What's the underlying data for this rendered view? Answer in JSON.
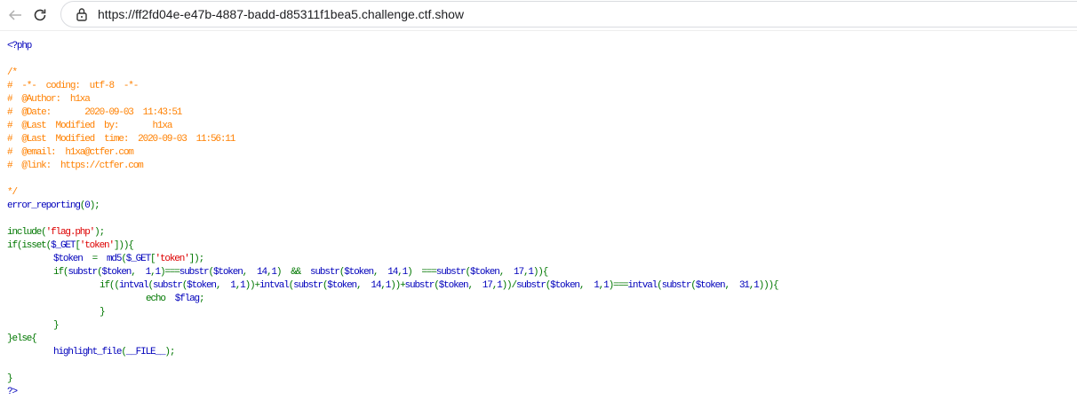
{
  "browser": {
    "url": "https://ff2fd04e-e47b-4887-badd-d85311f1bea5.challenge.ctf.show"
  },
  "colors": {
    "default": "#0000BB",
    "keyword": "#007700",
    "string": "#DD0000",
    "comment": "#FF8000"
  },
  "code_lines": [
    {
      "indent": 0,
      "t": [
        [
          "b",
          "<?php"
        ]
      ]
    },
    {
      "indent": 0,
      "t": []
    },
    {
      "indent": 0,
      "t": [
        [
          "o",
          "/*"
        ]
      ]
    },
    {
      "indent": 0,
      "t": [
        [
          "o",
          "#  -*-  coding:  utf-8  -*-"
        ]
      ]
    },
    {
      "indent": 0,
      "t": [
        [
          "o",
          "#  @Author:  h1xa"
        ]
      ]
    },
    {
      "indent": 0,
      "t": [
        [
          "o",
          "#  @Date:       2020-09-03  11:43:51"
        ]
      ]
    },
    {
      "indent": 0,
      "t": [
        [
          "o",
          "#  @Last  Modified  by:       h1xa"
        ]
      ]
    },
    {
      "indent": 0,
      "t": [
        [
          "o",
          "#  @Last  Modified  time:  2020-09-03  11:56:11"
        ]
      ]
    },
    {
      "indent": 0,
      "t": [
        [
          "o",
          "#  @email:  h1xa@ctfer.com"
        ]
      ]
    },
    {
      "indent": 0,
      "t": [
        [
          "o",
          "#  @link:  https://ctfer.com"
        ]
      ]
    },
    {
      "indent": 0,
      "t": []
    },
    {
      "indent": 0,
      "t": [
        [
          "o",
          "*/"
        ]
      ]
    },
    {
      "indent": 0,
      "t": [
        [
          "b",
          "error_reporting"
        ],
        [
          "g",
          "("
        ],
        [
          "b",
          "0"
        ],
        [
          "g",
          ");"
        ]
      ]
    },
    {
      "indent": 0,
      "t": []
    },
    {
      "indent": 0,
      "t": [
        [
          "g",
          "include("
        ],
        [
          "r",
          "'flag.php'"
        ],
        [
          "g",
          ");"
        ]
      ]
    },
    {
      "indent": 0,
      "t": [
        [
          "g",
          "if(isset("
        ],
        [
          "b",
          "$_GET"
        ],
        [
          "g",
          "["
        ],
        [
          "r",
          "'token'"
        ],
        [
          "g",
          "])){"
        ]
      ]
    },
    {
      "indent": 1,
      "t": [
        [
          "b",
          "$token  "
        ],
        [
          "g",
          "=  "
        ],
        [
          "b",
          "md5"
        ],
        [
          "g",
          "("
        ],
        [
          "b",
          "$_GET"
        ],
        [
          "g",
          "["
        ],
        [
          "r",
          "'token'"
        ],
        [
          "g",
          "]);"
        ]
      ]
    },
    {
      "indent": 1,
      "t": [
        [
          "g",
          "if("
        ],
        [
          "b",
          "substr"
        ],
        [
          "g",
          "("
        ],
        [
          "b",
          "$token"
        ],
        [
          "g",
          ",  "
        ],
        [
          "b",
          "1"
        ],
        [
          "g",
          ","
        ],
        [
          "b",
          "1"
        ],
        [
          "g",
          ")==="
        ],
        [
          "b",
          "substr"
        ],
        [
          "g",
          "("
        ],
        [
          "b",
          "$token"
        ],
        [
          "g",
          ",  "
        ],
        [
          "b",
          "14"
        ],
        [
          "g",
          ","
        ],
        [
          "b",
          "1"
        ],
        [
          "g",
          ")  &&  "
        ],
        [
          "b",
          "substr"
        ],
        [
          "g",
          "("
        ],
        [
          "b",
          "$token"
        ],
        [
          "g",
          ",  "
        ],
        [
          "b",
          "14"
        ],
        [
          "g",
          ","
        ],
        [
          "b",
          "1"
        ],
        [
          "g",
          ")  ==="
        ],
        [
          "b",
          "substr"
        ],
        [
          "g",
          "("
        ],
        [
          "b",
          "$token"
        ],
        [
          "g",
          ",  "
        ],
        [
          "b",
          "17"
        ],
        [
          "g",
          ","
        ],
        [
          "b",
          "1"
        ],
        [
          "g",
          ")){"
        ]
      ]
    },
    {
      "indent": 2,
      "t": [
        [
          "g",
          "if(("
        ],
        [
          "b",
          "intval"
        ],
        [
          "g",
          "("
        ],
        [
          "b",
          "substr"
        ],
        [
          "g",
          "("
        ],
        [
          "b",
          "$token"
        ],
        [
          "g",
          ",  "
        ],
        [
          "b",
          "1"
        ],
        [
          "g",
          ","
        ],
        [
          "b",
          "1"
        ],
        [
          "g",
          "))+"
        ],
        [
          "b",
          "intval"
        ],
        [
          "g",
          "("
        ],
        [
          "b",
          "substr"
        ],
        [
          "g",
          "("
        ],
        [
          "b",
          "$token"
        ],
        [
          "g",
          ",  "
        ],
        [
          "b",
          "14"
        ],
        [
          "g",
          ","
        ],
        [
          "b",
          "1"
        ],
        [
          "g",
          "))+"
        ],
        [
          "b",
          "substr"
        ],
        [
          "g",
          "("
        ],
        [
          "b",
          "$token"
        ],
        [
          "g",
          ",  "
        ],
        [
          "b",
          "17"
        ],
        [
          "g",
          ","
        ],
        [
          "b",
          "1"
        ],
        [
          "g",
          "))/"
        ],
        [
          "b",
          "substr"
        ],
        [
          "g",
          "("
        ],
        [
          "b",
          "$token"
        ],
        [
          "g",
          ",  "
        ],
        [
          "b",
          "1"
        ],
        [
          "g",
          ","
        ],
        [
          "b",
          "1"
        ],
        [
          "g",
          ")==="
        ],
        [
          "b",
          "intval"
        ],
        [
          "g",
          "("
        ],
        [
          "b",
          "substr"
        ],
        [
          "g",
          "("
        ],
        [
          "b",
          "$token"
        ],
        [
          "g",
          ",  "
        ],
        [
          "b",
          "31"
        ],
        [
          "g",
          ","
        ],
        [
          "b",
          "1"
        ],
        [
          "g",
          "))){"
        ]
      ]
    },
    {
      "indent": 3,
      "t": [
        [
          "g",
          "echo  "
        ],
        [
          "b",
          "$flag"
        ],
        [
          "g",
          ";"
        ]
      ]
    },
    {
      "indent": 2,
      "t": [
        [
          "g",
          "}"
        ]
      ]
    },
    {
      "indent": 1,
      "t": [
        [
          "g",
          "}"
        ]
      ]
    },
    {
      "indent": 0,
      "t": [
        [
          "g",
          "}else{"
        ]
      ]
    },
    {
      "indent": 1,
      "t": [
        [
          "b",
          "highlight_file"
        ],
        [
          "g",
          "("
        ],
        [
          "b",
          "__FILE__"
        ],
        [
          "g",
          ");"
        ]
      ]
    },
    {
      "indent": 0,
      "t": []
    },
    {
      "indent": 0,
      "t": [
        [
          "g",
          "}"
        ]
      ]
    },
    {
      "indent": 0,
      "t": [
        [
          "b",
          "?>"
        ]
      ]
    }
  ]
}
